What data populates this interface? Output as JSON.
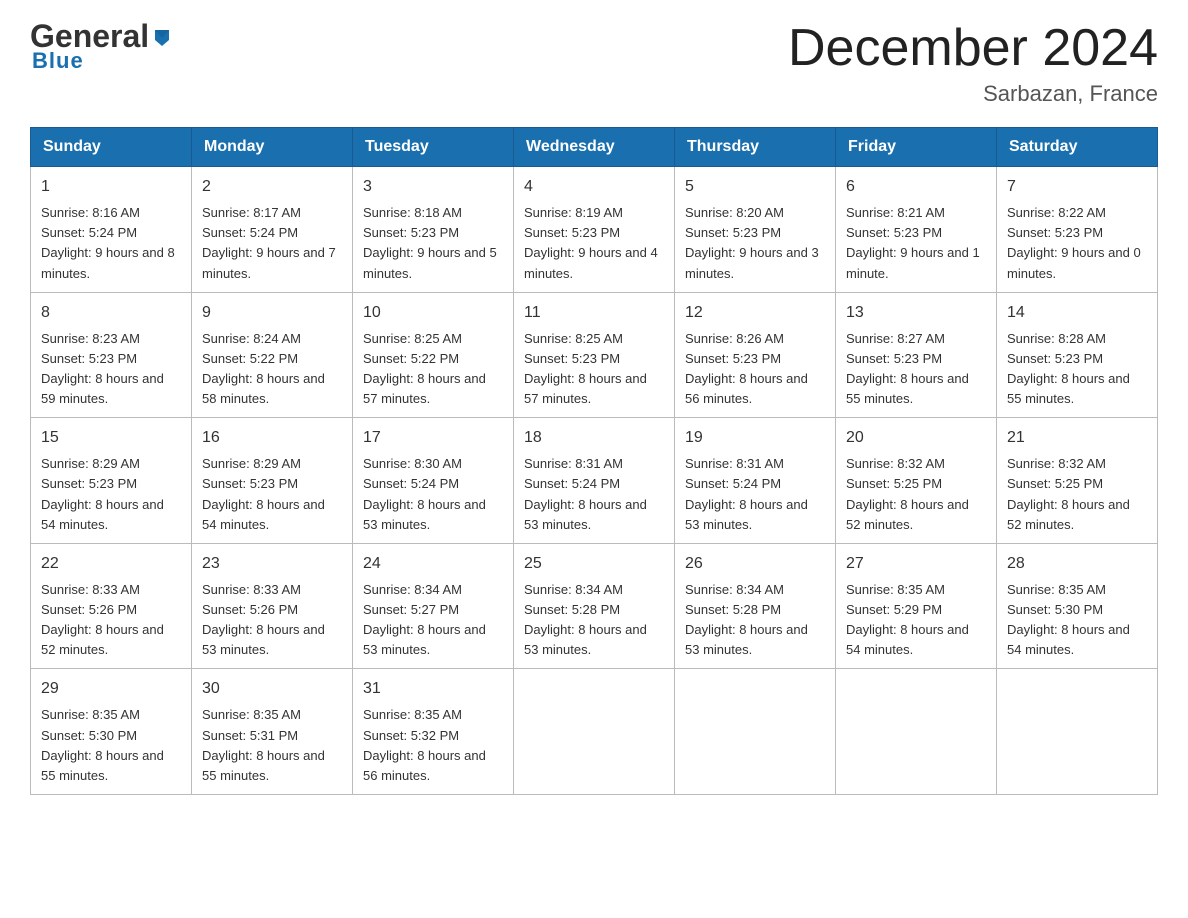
{
  "header": {
    "logo_general": "General",
    "logo_blue": "Blue",
    "month_title": "December 2024",
    "location": "Sarbazan, France"
  },
  "days_of_week": [
    "Sunday",
    "Monday",
    "Tuesday",
    "Wednesday",
    "Thursday",
    "Friday",
    "Saturday"
  ],
  "weeks": [
    [
      {
        "day": "1",
        "sunrise": "8:16 AM",
        "sunset": "5:24 PM",
        "daylight": "9 hours and 8 minutes."
      },
      {
        "day": "2",
        "sunrise": "8:17 AM",
        "sunset": "5:24 PM",
        "daylight": "9 hours and 7 minutes."
      },
      {
        "day": "3",
        "sunrise": "8:18 AM",
        "sunset": "5:23 PM",
        "daylight": "9 hours and 5 minutes."
      },
      {
        "day": "4",
        "sunrise": "8:19 AM",
        "sunset": "5:23 PM",
        "daylight": "9 hours and 4 minutes."
      },
      {
        "day": "5",
        "sunrise": "8:20 AM",
        "sunset": "5:23 PM",
        "daylight": "9 hours and 3 minutes."
      },
      {
        "day": "6",
        "sunrise": "8:21 AM",
        "sunset": "5:23 PM",
        "daylight": "9 hours and 1 minute."
      },
      {
        "day": "7",
        "sunrise": "8:22 AM",
        "sunset": "5:23 PM",
        "daylight": "9 hours and 0 minutes."
      }
    ],
    [
      {
        "day": "8",
        "sunrise": "8:23 AM",
        "sunset": "5:23 PM",
        "daylight": "8 hours and 59 minutes."
      },
      {
        "day": "9",
        "sunrise": "8:24 AM",
        "sunset": "5:22 PM",
        "daylight": "8 hours and 58 minutes."
      },
      {
        "day": "10",
        "sunrise": "8:25 AM",
        "sunset": "5:22 PM",
        "daylight": "8 hours and 57 minutes."
      },
      {
        "day": "11",
        "sunrise": "8:25 AM",
        "sunset": "5:23 PM",
        "daylight": "8 hours and 57 minutes."
      },
      {
        "day": "12",
        "sunrise": "8:26 AM",
        "sunset": "5:23 PM",
        "daylight": "8 hours and 56 minutes."
      },
      {
        "day": "13",
        "sunrise": "8:27 AM",
        "sunset": "5:23 PM",
        "daylight": "8 hours and 55 minutes."
      },
      {
        "day": "14",
        "sunrise": "8:28 AM",
        "sunset": "5:23 PM",
        "daylight": "8 hours and 55 minutes."
      }
    ],
    [
      {
        "day": "15",
        "sunrise": "8:29 AM",
        "sunset": "5:23 PM",
        "daylight": "8 hours and 54 minutes."
      },
      {
        "day": "16",
        "sunrise": "8:29 AM",
        "sunset": "5:23 PM",
        "daylight": "8 hours and 54 minutes."
      },
      {
        "day": "17",
        "sunrise": "8:30 AM",
        "sunset": "5:24 PM",
        "daylight": "8 hours and 53 minutes."
      },
      {
        "day": "18",
        "sunrise": "8:31 AM",
        "sunset": "5:24 PM",
        "daylight": "8 hours and 53 minutes."
      },
      {
        "day": "19",
        "sunrise": "8:31 AM",
        "sunset": "5:24 PM",
        "daylight": "8 hours and 53 minutes."
      },
      {
        "day": "20",
        "sunrise": "8:32 AM",
        "sunset": "5:25 PM",
        "daylight": "8 hours and 52 minutes."
      },
      {
        "day": "21",
        "sunrise": "8:32 AM",
        "sunset": "5:25 PM",
        "daylight": "8 hours and 52 minutes."
      }
    ],
    [
      {
        "day": "22",
        "sunrise": "8:33 AM",
        "sunset": "5:26 PM",
        "daylight": "8 hours and 52 minutes."
      },
      {
        "day": "23",
        "sunrise": "8:33 AM",
        "sunset": "5:26 PM",
        "daylight": "8 hours and 53 minutes."
      },
      {
        "day": "24",
        "sunrise": "8:34 AM",
        "sunset": "5:27 PM",
        "daylight": "8 hours and 53 minutes."
      },
      {
        "day": "25",
        "sunrise": "8:34 AM",
        "sunset": "5:28 PM",
        "daylight": "8 hours and 53 minutes."
      },
      {
        "day": "26",
        "sunrise": "8:34 AM",
        "sunset": "5:28 PM",
        "daylight": "8 hours and 53 minutes."
      },
      {
        "day": "27",
        "sunrise": "8:35 AM",
        "sunset": "5:29 PM",
        "daylight": "8 hours and 54 minutes."
      },
      {
        "day": "28",
        "sunrise": "8:35 AM",
        "sunset": "5:30 PM",
        "daylight": "8 hours and 54 minutes."
      }
    ],
    [
      {
        "day": "29",
        "sunrise": "8:35 AM",
        "sunset": "5:30 PM",
        "daylight": "8 hours and 55 minutes."
      },
      {
        "day": "30",
        "sunrise": "8:35 AM",
        "sunset": "5:31 PM",
        "daylight": "8 hours and 55 minutes."
      },
      {
        "day": "31",
        "sunrise": "8:35 AM",
        "sunset": "5:32 PM",
        "daylight": "8 hours and 56 minutes."
      },
      null,
      null,
      null,
      null
    ]
  ],
  "labels": {
    "sunrise_prefix": "Sunrise: ",
    "sunset_prefix": "Sunset: ",
    "daylight_prefix": "Daylight: "
  }
}
